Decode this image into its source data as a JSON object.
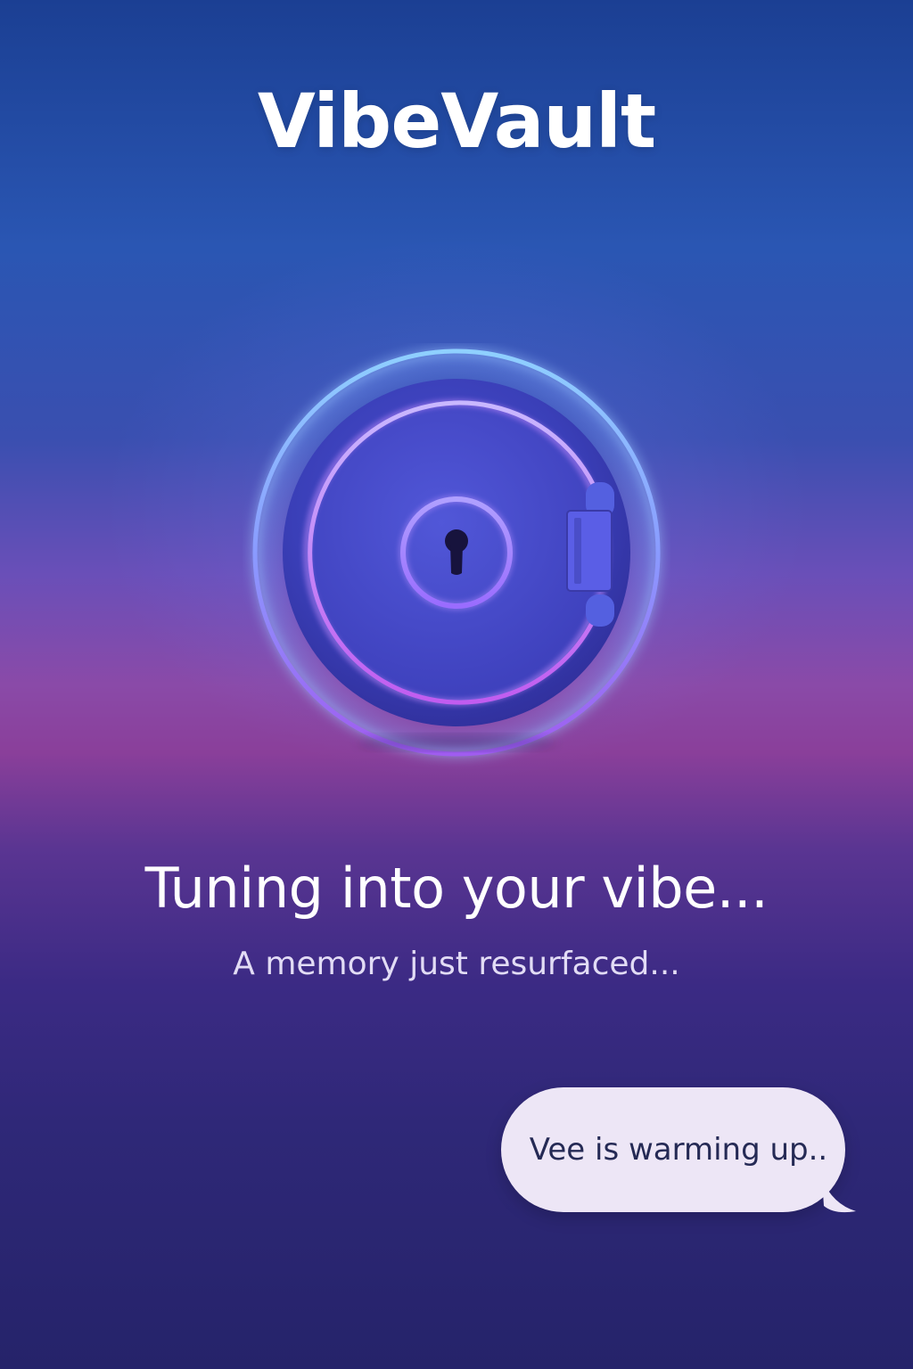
{
  "app": {
    "title": "VibeVault"
  },
  "loading": {
    "headline": "Tuning into your vibe...",
    "subline": "A memory just resurfaced..."
  },
  "assistant": {
    "message": "Vee is warming up.."
  },
  "icons": {
    "vault": "vault-lock-icon",
    "keyhole": "keyhole-icon"
  },
  "colors": {
    "background_top": "#1b3f93",
    "background_mid": "#8a4aa8",
    "background_bottom": "#25236a",
    "ring_glow": "#7fb4ff",
    "ring_accent": "#b45cf2",
    "bubble": "#ede6f6",
    "bubble_text": "#252a55"
  }
}
